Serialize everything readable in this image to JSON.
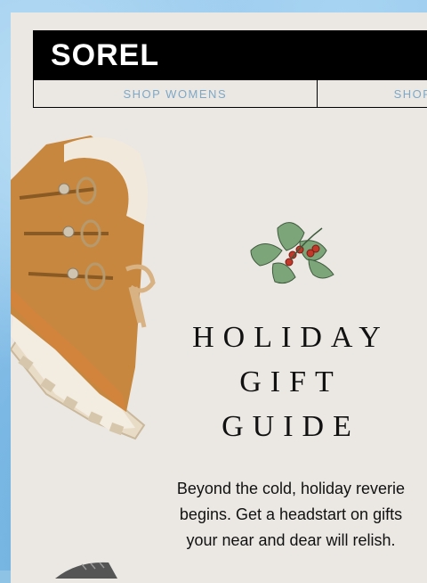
{
  "brand": {
    "logo_text": "SOREL"
  },
  "nav": {
    "items": [
      {
        "label": "SHOP WOMENS"
      },
      {
        "label": "SHOP"
      }
    ]
  },
  "hero": {
    "title_lines": [
      "HOLIDAY",
      "GIFT",
      "GUIDE"
    ],
    "body_lines": [
      "Beyond the cold, holiday reverie",
      "begins. Get a headstart on gifts",
      "your near and dear will relish."
    ]
  },
  "colors": {
    "nav_text": "#7ea8c7",
    "header_bg": "#000000",
    "card_bg": "#ebe8e3",
    "boot_tan": "#c8873f"
  },
  "icons": {
    "holly": "holly-icon",
    "boot": "boot-image"
  }
}
